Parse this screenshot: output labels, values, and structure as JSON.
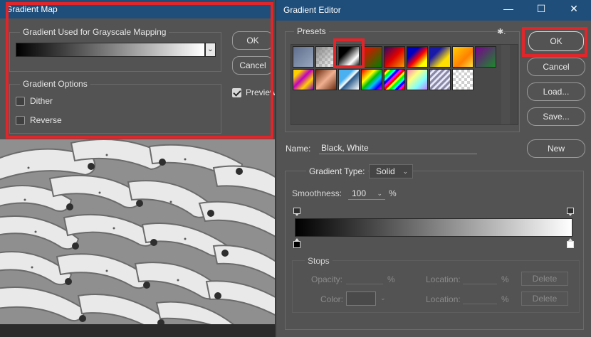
{
  "gradient_map": {
    "title": "Gradient Map",
    "group_used_label": "Gradient Used for Grayscale Mapping",
    "options_label": "Gradient Options",
    "dither_label": "Dither",
    "reverse_label": "Reverse",
    "ok_label": "OK",
    "cancel_label": "Cancel",
    "preview_label": "Preview",
    "preview_checked": true
  },
  "gradient_editor": {
    "title": "Gradient Editor",
    "controls": {
      "minimize": "—",
      "maximize": "☐",
      "close": "✕"
    },
    "presets_label": "Presets",
    "gear_symbol": "✱.",
    "buttons": {
      "ok": "OK",
      "cancel": "Cancel",
      "load": "Load...",
      "save": "Save...",
      "new": "New"
    },
    "name_label": "Name:",
    "name_value": "Black, White",
    "gradient_type_label": "Gradient Type:",
    "gradient_type_value": "Solid",
    "smoothness_label": "Smoothness:",
    "smoothness_value": "100",
    "percent": "%",
    "stops_label": "Stops",
    "opacity_label": "Opacity:",
    "color_label": "Color:",
    "location_label": "Location:",
    "delete_label": "Delete",
    "preset_swatches": [
      "blue-gray",
      "transparent-gray",
      "black-white",
      "red-green",
      "multi-color",
      "blue-red-yellow",
      "blue-yellow",
      "yellow-orange",
      "purple-green",
      "violet-orange",
      "copper",
      "chrome",
      "rainbow-spectrum",
      "rainbow-stripes",
      "pastel-spectrum",
      "diagonal-stripes",
      "checkerboard"
    ]
  }
}
